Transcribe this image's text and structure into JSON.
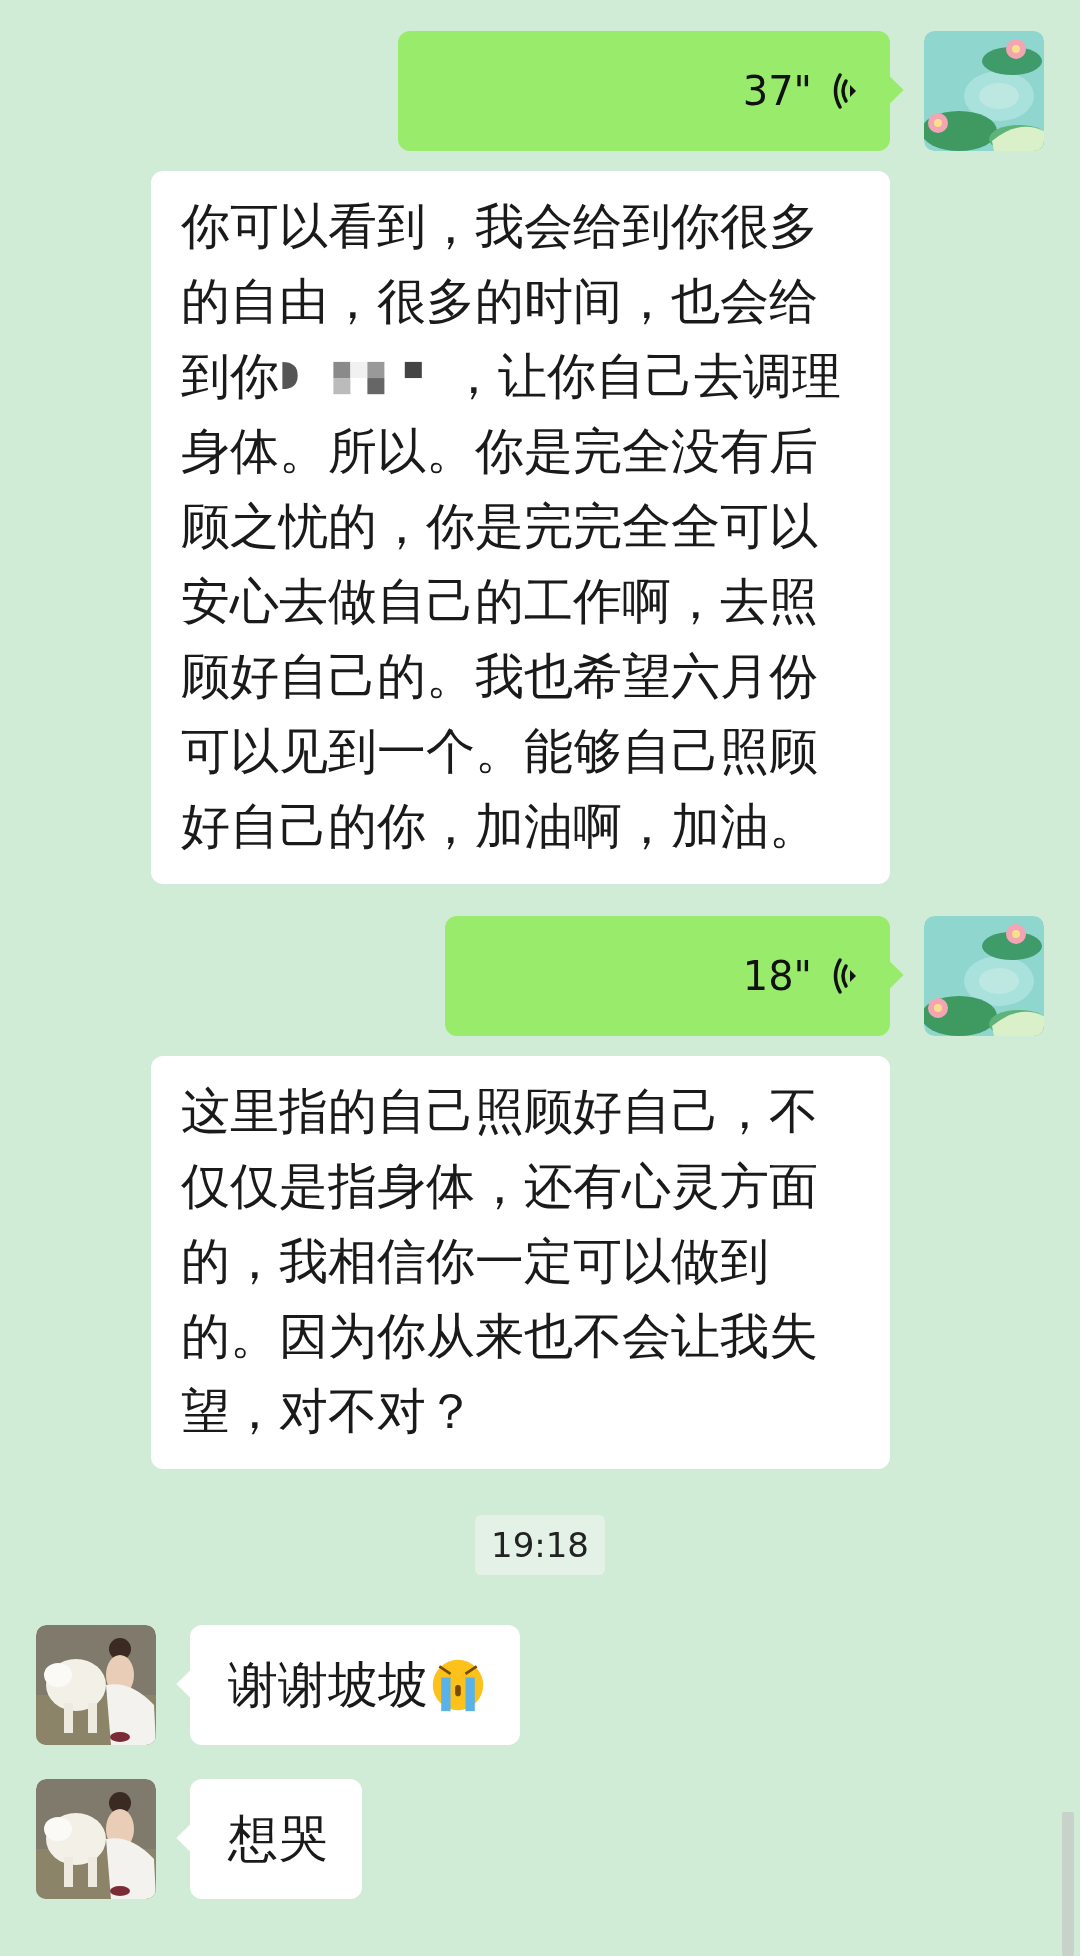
{
  "messages": [
    {
      "kind": "voice",
      "outgoing": true,
      "duration": "37\"",
      "transcript": [
        {
          "kind": "text",
          "text": "你可以看到，我会给到你很多的自由，很多的时间，也会给到你"
        },
        {
          "kind": "redacted"
        },
        {
          "kind": "text",
          "text": "，让你自己去调理身体。所以。你是完全没有后顾之忧的，你是完完全全可以安心去做自己的工作啊，去照顾好自己的。我也希望六月份可以见到一个。能够自己照顾好自己的你，加油啊，加油。"
        }
      ]
    },
    {
      "kind": "voice",
      "outgoing": true,
      "duration": "18\"",
      "transcript": [
        {
          "kind": "text",
          "text": "这里指的自己照顾好自己，不仅仅是指身体，还有心灵方面的，我相信你一定可以做到的。因为你从来也不会让我失望，对不对？"
        }
      ]
    },
    {
      "kind": "time",
      "text": "19:18"
    },
    {
      "kind": "text",
      "outgoing": false,
      "content": [
        {
          "kind": "text",
          "text": "谢谢坡坡"
        },
        {
          "kind": "emoji"
        }
      ]
    },
    {
      "kind": "text",
      "outgoing": false,
      "content": [
        {
          "kind": "text",
          "text": "想哭"
        }
      ]
    }
  ]
}
